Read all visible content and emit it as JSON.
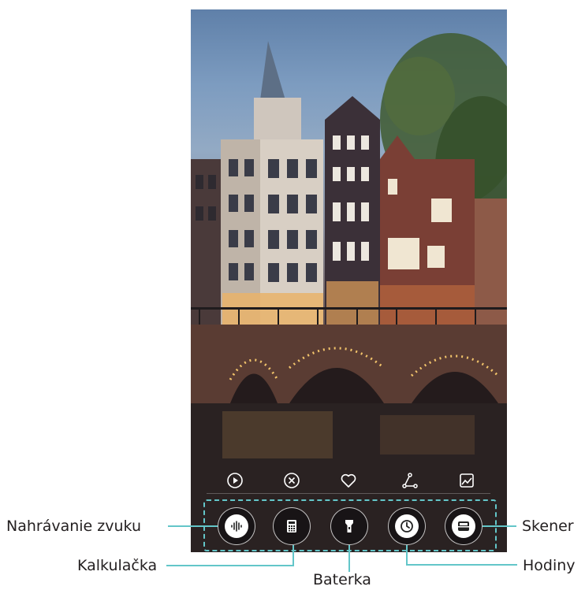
{
  "lockscreen": {
    "shortcuts": [
      {
        "icon": "play-circle-icon"
      },
      {
        "icon": "close-circle-icon"
      },
      {
        "icon": "heart-icon"
      },
      {
        "icon": "share-icon"
      },
      {
        "icon": "gallery-icon"
      }
    ],
    "apps": [
      {
        "icon": "sound-recorder-icon"
      },
      {
        "icon": "calculator-icon"
      },
      {
        "icon": "flashlight-icon"
      },
      {
        "icon": "clock-icon"
      },
      {
        "icon": "scanner-icon"
      }
    ]
  },
  "callouts": {
    "recorder": "Nahrávanie zvuku",
    "calculator": "Kalkulačka",
    "flashlight": "Baterka",
    "clock": "Hodiny",
    "scanner": "Skener"
  },
  "colors": {
    "highlight": "#63c6c9",
    "label": "#231f20"
  }
}
